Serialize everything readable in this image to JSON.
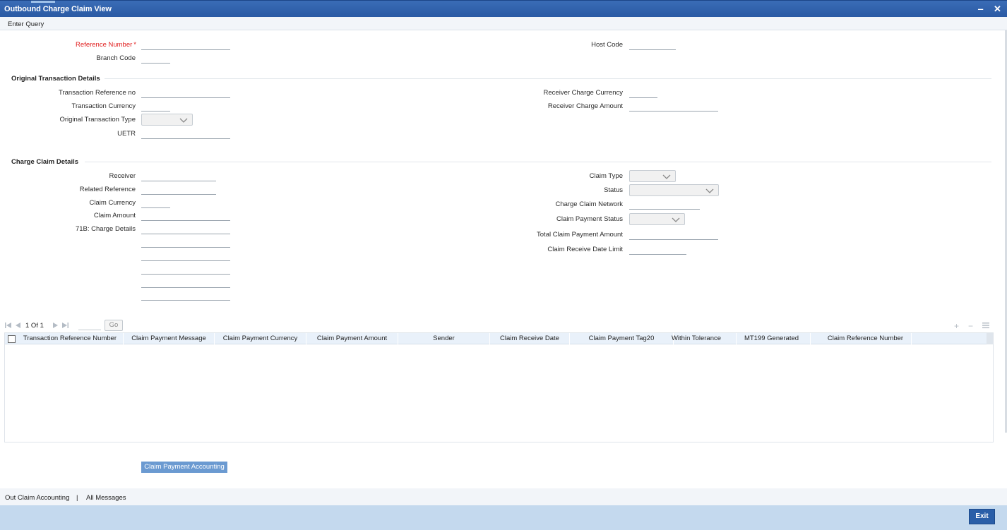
{
  "window": {
    "title": "Outbound Charge Claim View",
    "minimize_glyph": "‒",
    "close_glyph": "✕"
  },
  "toolbar": {
    "enter_query": "Enter Query"
  },
  "header": {
    "reference_number_label": "Reference Number",
    "required_marker": "*",
    "branch_code_label": "Branch Code",
    "host_code_label": "Host Code"
  },
  "original_txn": {
    "section_title": "Original Transaction Details",
    "txn_ref_label": "Transaction Reference no",
    "txn_currency_label": "Transaction Currency",
    "orig_txn_type_label": "Original Transaction Type",
    "uetr_label": "UETR",
    "recv_charge_currency_label": "Receiver Charge Currency",
    "recv_charge_amount_label": "Receiver Charge Amount"
  },
  "charge_claim": {
    "section_title": "Charge Claim Details",
    "receiver_label": "Receiver",
    "related_ref_label": "Related Reference",
    "claim_currency_label": "Claim Currency",
    "claim_amount_label": "Claim Amount",
    "charge_details_label": "71B: Charge Details",
    "claim_type_label": "Claim Type",
    "status_label": "Status",
    "network_label": "Charge Claim Network",
    "payment_status_label": "Claim Payment Status",
    "total_payment_label": "Total Claim Payment Amount",
    "receive_date_limit_label": "Claim Receive Date Limit"
  },
  "grid": {
    "page_info": "1 Of 1",
    "go_label": "Go",
    "add_glyph": "+",
    "remove_glyph": "−",
    "columns": [
      "Transaction Reference Number",
      "Claim Payment Message",
      "Claim Payment Currency",
      "Claim Payment Amount",
      "Sender",
      "Claim Receive Date",
      "Claim Payment Tag20",
      "Within Tolerance",
      "MT199 Generated",
      "Claim Reference Number"
    ]
  },
  "actions": {
    "claim_payment_accounting": "Claim Payment Accounting"
  },
  "footer": {
    "out_claim_accounting": "Out Claim Accounting",
    "separator": "|",
    "all_messages": "All Messages",
    "exit": "Exit"
  }
}
